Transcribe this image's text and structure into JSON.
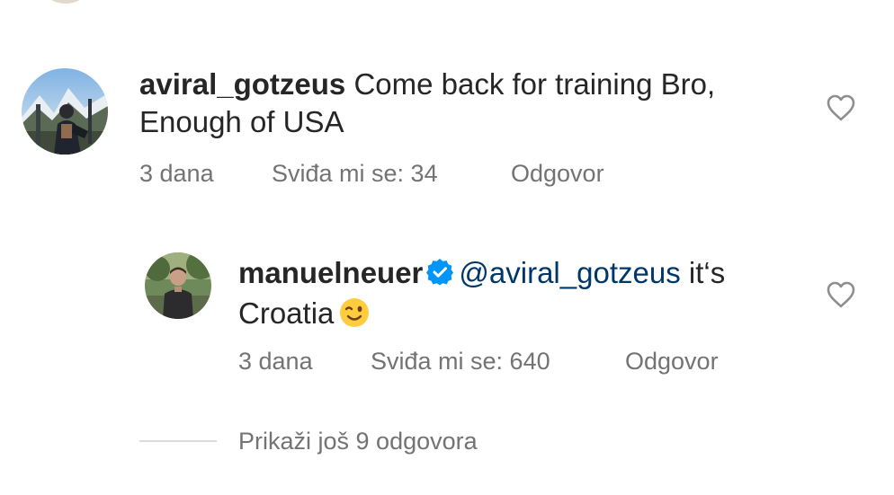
{
  "colors": {
    "text_primary": "#262626",
    "text_secondary": "#737373",
    "mention": "#00376b",
    "verified_badge": "#0095f6",
    "divider": "#dbdbdb"
  },
  "comments": [
    {
      "username": "aviral_gotzeus",
      "text": "Come back for training Bro, Enough of USA",
      "time": "3 dana",
      "likes": "Sviđa mi se: 34",
      "reply": "Odgovor",
      "icons": [
        "avatar",
        "heart-icon"
      ]
    },
    {
      "username": "manuelneuer",
      "verified": true,
      "mention": "@aviral_gotzeus",
      "text": "it‘s Croatia",
      "emoji": "😉",
      "time": "3 dana",
      "likes": "Sviđa mi se: 640",
      "reply": "Odgovor",
      "icons": [
        "avatar",
        "verified-badge-icon",
        "winking-face-emoji",
        "heart-icon"
      ]
    }
  ],
  "show_more_replies": "Prikaži još 9 odgovora"
}
